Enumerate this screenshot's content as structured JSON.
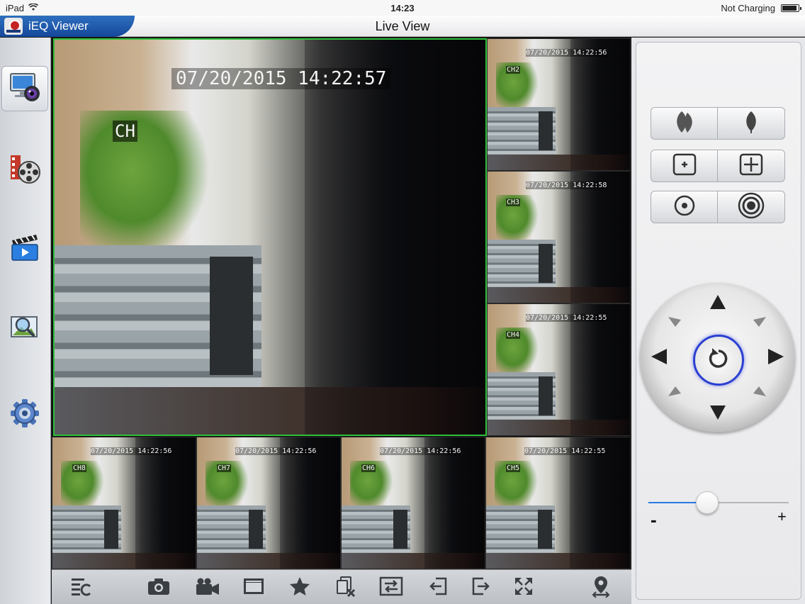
{
  "status_bar": {
    "device": "iPad",
    "time": "14:23",
    "charging": "Not Charging"
  },
  "app": {
    "title": "iEQ Viewer",
    "page_title": "Live View"
  },
  "sidebar": {
    "items": [
      {
        "name": "live-view",
        "icon": "monitor-camera-icon",
        "active": true
      },
      {
        "name": "playback",
        "icon": "film-reel-icon",
        "active": false
      },
      {
        "name": "video-files",
        "icon": "clapperboard-icon",
        "active": false
      },
      {
        "name": "image-search",
        "icon": "magnifier-picture-icon",
        "active": false
      },
      {
        "name": "settings",
        "icon": "gear-icon",
        "active": false
      }
    ]
  },
  "cameras": {
    "main": {
      "timestamp": "07/20/2015 14:22:57",
      "channel": "CH"
    },
    "ch2": {
      "timestamp": "07/20/2015 14:22:56",
      "channel": "CH2"
    },
    "ch3": {
      "timestamp": "07/20/2015 14:22:58",
      "channel": "CH3"
    },
    "ch4": {
      "timestamp": "07/20/2015 14:22:55",
      "channel": "CH4"
    },
    "ch8": {
      "timestamp": "07/20/2015 14:22:56",
      "channel": "CH8"
    },
    "ch7": {
      "timestamp": "07/20/2015 14:22:56",
      "channel": "CH7"
    },
    "ch6": {
      "timestamp": "07/20/2015 14:22:56",
      "channel": "CH6"
    },
    "ch5": {
      "timestamp": "07/20/2015 14:22:55",
      "channel": "CH5"
    }
  },
  "toolbar": {
    "buttons": [
      "layout-icon",
      "camera-snapshot-icon",
      "video-record-icon",
      "folder-icon",
      "star-icon",
      "close-all-icon",
      "switch-stream-icon",
      "previous-icon",
      "next-icon",
      "fullscreen-icon",
      "ptz-location-icon"
    ]
  },
  "ptz": {
    "buttons": [
      "focus-far-icon",
      "focus-near-icon",
      "zoom-out-icon",
      "zoom-in-icon",
      "iris-close-icon",
      "iris-open-icon"
    ],
    "directions": [
      "up",
      "down",
      "left",
      "right",
      "up-left",
      "up-right",
      "down-left",
      "down-right"
    ],
    "center_icon": "rotate-reset-icon",
    "accent": "#2b3fd1"
  },
  "speed_slider": {
    "min_label": "-",
    "max_label": "+",
    "value": 0.42,
    "accent": "#2a7ae2"
  }
}
